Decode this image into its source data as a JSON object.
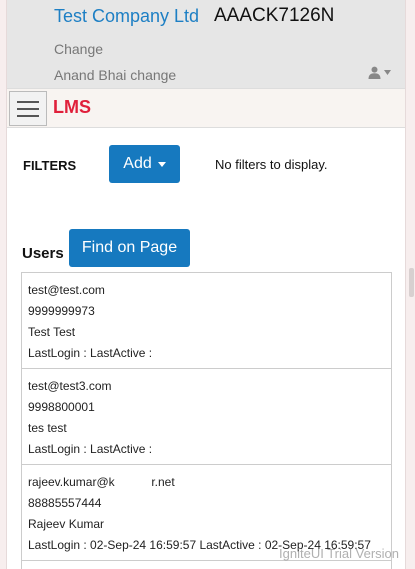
{
  "header": {
    "company_name": "Test Company Ltd",
    "company_code": "AAACK7126N",
    "change_label": "Change",
    "user_change_label": "Anand Bhai change"
  },
  "navbar": {
    "brand": "LMS"
  },
  "filters": {
    "label": "FILTERS",
    "add_label": "Add",
    "empty_message": "No filters to display."
  },
  "users": {
    "label": "Users",
    "find_label": "Find on Page",
    "items": [
      {
        "email": "test@test.com",
        "phone": "9999999973",
        "name": "Test Test",
        "last": "LastLogin : LastActive :"
      },
      {
        "email": "test@test3.com",
        "phone": "9998800001",
        "name": "tes test",
        "last": "LastLogin : LastActive :"
      },
      {
        "email": "rajeev.kumar@k           r.net",
        "phone": "88885557444",
        "name": "Rajeev Kumar",
        "last": "LastLogin : 02-Sep-24 16:59:57 LastActive : 02-Sep-24 16:59:57"
      }
    ]
  },
  "watermark": "IgniteUI Trial Version",
  "colors": {
    "accent": "#1679bf",
    "brand": "#e0203b",
    "company": "#1d7fc4"
  },
  "icons": {
    "user_menu": "user-icon",
    "nav_toggle": "hamburger-menu-icon"
  }
}
